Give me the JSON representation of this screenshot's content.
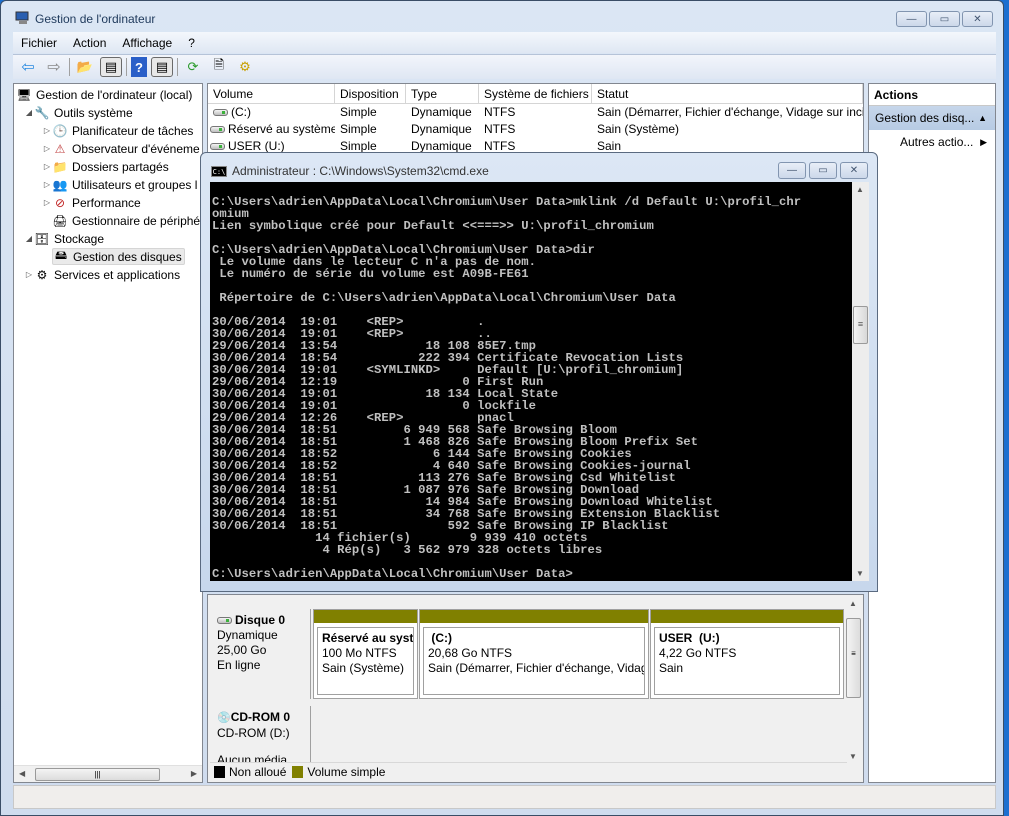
{
  "main_window": {
    "title": "Gestion de l'ordinateur",
    "controls": {
      "minimize": "—",
      "maximize": "▭",
      "close": "✕"
    }
  },
  "menu": [
    "Fichier",
    "Action",
    "Affichage",
    "?"
  ],
  "toolbar": {
    "buttons": [
      "back-arrow",
      "forward-arrow",
      "up-folder",
      "show-hide-console-tree",
      "help",
      "show-hide-action-pane",
      "refresh",
      "properties",
      "disk-settings"
    ],
    "glyphs": {
      "back": "⇦",
      "forward": "⇨",
      "up": "📂",
      "console": "▤",
      "help": "?",
      "action": "▤",
      "refresh": "⟳",
      "properties": "🗎",
      "settings": "⚙"
    }
  },
  "tree": {
    "items": [
      {
        "label": "Gestion de l'ordinateur (local)",
        "level": 0,
        "arrow": "",
        "icon": "computer-icon",
        "glyph": "🖥"
      },
      {
        "label": "Outils système",
        "level": 1,
        "arrow": "◢",
        "icon": "tools-icon",
        "glyph": "🔧"
      },
      {
        "label": "Planificateur de tâches",
        "level": 2,
        "arrow": "▷",
        "icon": "clock-icon",
        "glyph": "🕒"
      },
      {
        "label": "Observateur d'événeme",
        "level": 2,
        "arrow": "▷",
        "icon": "event-viewer-icon",
        "glyph": "⚠"
      },
      {
        "label": "Dossiers partagés",
        "level": 2,
        "arrow": "▷",
        "icon": "shared-folder-icon",
        "glyph": "📁"
      },
      {
        "label": "Utilisateurs et groupes l",
        "level": 2,
        "arrow": "▷",
        "icon": "users-icon",
        "glyph": "👥"
      },
      {
        "label": "Performance",
        "level": 2,
        "arrow": "▷",
        "icon": "performance-icon",
        "glyph": "⊘"
      },
      {
        "label": "Gestionnaire de périphé",
        "level": 2,
        "arrow": "",
        "icon": "device-manager-icon",
        "glyph": "🖨"
      },
      {
        "label": "Stockage",
        "level": 1,
        "arrow": "◢",
        "icon": "storage-icon",
        "glyph": "🗄"
      },
      {
        "label": "Gestion des disques",
        "level": 2,
        "arrow": "",
        "icon": "disk-management-icon",
        "glyph": "🖴",
        "selected": true
      },
      {
        "label": "Services et applications",
        "level": 0.5,
        "arrow": "▷",
        "icon": "services-icon",
        "glyph": "⚙"
      }
    ]
  },
  "volumes": {
    "headers": [
      "Volume",
      "Disposition",
      "Type",
      "Système de fichiers",
      "Statut"
    ],
    "rows": [
      [
        "(C:)",
        "Simple",
        "Dynamique",
        "NTFS",
        "Sain (Démarrer, Fichier d'échange, Vidage sur incic"
      ],
      [
        "Réservé au système",
        "Simple",
        "Dynamique",
        "NTFS",
        "Sain (Système)"
      ],
      [
        "USER (U:)",
        "Simple",
        "Dynamique",
        "NTFS",
        "Sain"
      ]
    ]
  },
  "actions": {
    "title": "Actions",
    "group": "Gestion des disq...",
    "group_glyph": "▲",
    "item": "Autres actio...",
    "item_glyph": "▶"
  },
  "cmd": {
    "title": "Administrateur : C:\\Windows\\System32\\cmd.exe",
    "icon_text": "C:\\",
    "lines": [
      "C:\\Users\\adrien\\AppData\\Local\\Chromium\\User Data>mklink /d Default U:\\profil_chr",
      "omium",
      "Lien symbolique créé pour Default <<===>> U:\\profil_chromium",
      "",
      "C:\\Users\\adrien\\AppData\\Local\\Chromium\\User Data>dir",
      " Le volume dans le lecteur C n'a pas de nom.",
      " Le numéro de série du volume est A09B-FE61",
      "",
      " Répertoire de C:\\Users\\adrien\\AppData\\Local\\Chromium\\User Data",
      "",
      "30/06/2014  19:01    <REP>          .",
      "30/06/2014  19:01    <REP>          ..",
      "29/06/2014  13:54            18 108 85E7.tmp",
      "30/06/2014  18:54           222 394 Certificate Revocation Lists",
      "30/06/2014  19:01    <SYMLINKD>     Default [U:\\profil_chromium]",
      "29/06/2014  12:19                 0 First Run",
      "30/06/2014  19:01            18 134 Local State",
      "30/06/2014  19:01                 0 lockfile",
      "29/06/2014  12:26    <REP>          pnacl",
      "30/06/2014  18:51         6 949 568 Safe Browsing Bloom",
      "30/06/2014  18:51         1 468 826 Safe Browsing Bloom Prefix Set",
      "30/06/2014  18:52             6 144 Safe Browsing Cookies",
      "30/06/2014  18:52             4 640 Safe Browsing Cookies-journal",
      "30/06/2014  18:51           113 276 Safe Browsing Csd Whitelist",
      "30/06/2014  18:51         1 087 976 Safe Browsing Download",
      "30/06/2014  18:51            14 984 Safe Browsing Download Whitelist",
      "30/06/2014  18:51            34 768 Safe Browsing Extension Blacklist",
      "30/06/2014  18:51               592 Safe Browsing IP Blacklist",
      "              14 fichier(s)        9 939 410 octets",
      "               4 Rép(s)   3 562 979 328 octets libres",
      "",
      "C:\\Users\\adrien\\AppData\\Local\\Chromium\\User Data>"
    ]
  },
  "disks": [
    {
      "name": "Disque 0",
      "type": "Dynamique",
      "size": "25,00 Go",
      "state": "En ligne",
      "partitions": [
        {
          "name": "Réservé au systè",
          "size": "100 Mo NTFS",
          "status": "Sain (Système)"
        },
        {
          "name": " (C:)",
          "size": "20,68 Go NTFS",
          "status": "Sain (Démarrer, Fichier d'échange, Vidag"
        },
        {
          "name": "USER  (U:)",
          "size": "4,22 Go NTFS",
          "status": "Sain"
        }
      ]
    },
    {
      "name": "CD-ROM 0",
      "type": "CD-ROM (D:)",
      "state": "Aucun média"
    }
  ],
  "legend": [
    {
      "label": "Non alloué",
      "color": "#000000"
    },
    {
      "label": "Volume simple",
      "color": "#808000"
    }
  ],
  "colors": {
    "volume_band": "#808000",
    "console_bg": "#000000",
    "console_fg": "#c0c0c0"
  }
}
